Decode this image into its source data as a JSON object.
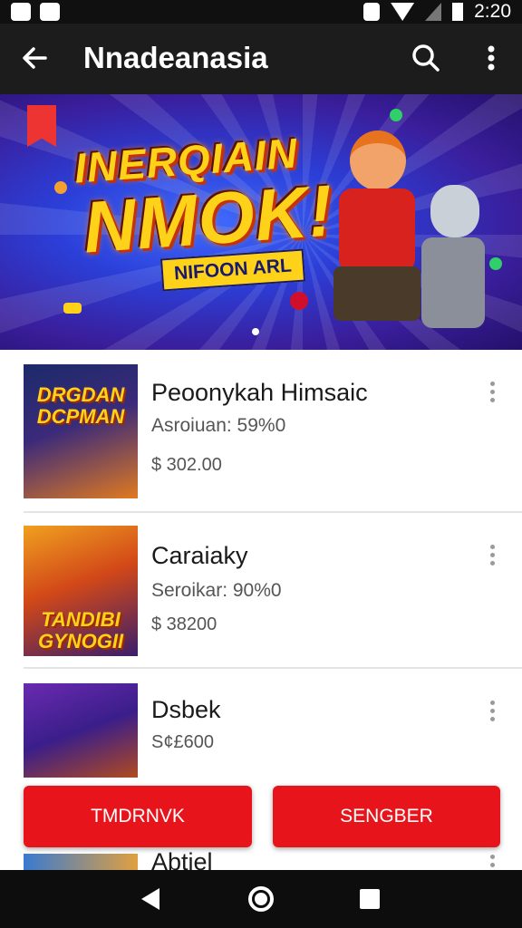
{
  "status_bar": {
    "time": "2:20",
    "icons": [
      "gmail-icon",
      "notification-icon",
      "vibrate-icon",
      "wifi-icon",
      "signal-icon",
      "battery-icon"
    ]
  },
  "app_bar": {
    "title": "Nnadeanasia",
    "icons": [
      "back-arrow-icon",
      "search-icon",
      "more-vert-icon"
    ]
  },
  "banner": {
    "title_line1": "INERQIAIN",
    "title_line2": "NMOK!",
    "subtitle": "NIFOON ARL"
  },
  "items": [
    {
      "title": "Peoonykah Himsaic",
      "subtitle": "Asroiuan: 59%0",
      "price": "$ 302.00",
      "thumb_text": "DRGDAN DCPMAN"
    },
    {
      "title": "Caraiaky",
      "subtitle": "Seroikar: 90%0",
      "price": "$ 38200",
      "thumb_text": "TANDIBI GYNOGII"
    },
    {
      "title": "Dsbek",
      "subtitle": "",
      "price": "S¢£600",
      "thumb_text": ""
    },
    {
      "title": "Abtiel",
      "subtitle": "",
      "price": "",
      "thumb_text": ""
    }
  ],
  "buttons": {
    "left": "TMDRNVK",
    "right": "SENGBER"
  },
  "colors": {
    "accent": "#e8141b",
    "app_bar": "#1c1c1c",
    "status_bar": "#101010"
  }
}
